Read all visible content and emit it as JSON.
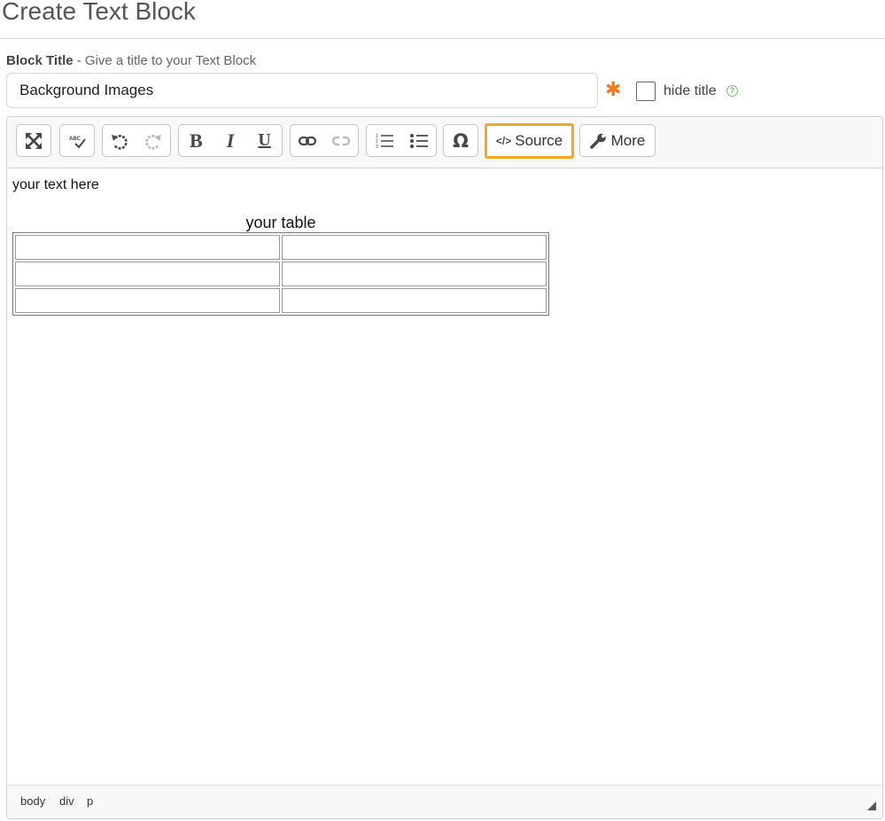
{
  "page": {
    "title": "Create Text Block"
  },
  "block_title": {
    "label_bold": "Block Title",
    "label_hint": " - Give a title to your Text Block",
    "value": "Background Images",
    "required_mark": "✱",
    "hide_title_label": "hide title",
    "hide_title_checked": false,
    "help_mark": "?"
  },
  "toolbar": {
    "source_label": "Source",
    "source_glyph": "</>",
    "more_label": "More",
    "buttons": [
      "maximize",
      "spell-check",
      "undo",
      "redo",
      "bold",
      "italic",
      "underline",
      "link",
      "unlink",
      "numbered-list",
      "bulleted-list",
      "special-character",
      "source",
      "more"
    ],
    "disabled_buttons": [
      "redo",
      "unlink"
    ],
    "highlight_color": "#f5a623"
  },
  "content": {
    "text": "your text here",
    "table_caption": "your table",
    "table_rows": 3,
    "table_cols": 2
  },
  "statusbar": {
    "path": [
      "body",
      "div",
      "p"
    ]
  },
  "colors": {
    "required": "#f07a1e",
    "help": "#7ab87a",
    "source_highlight": "#f5a623"
  }
}
